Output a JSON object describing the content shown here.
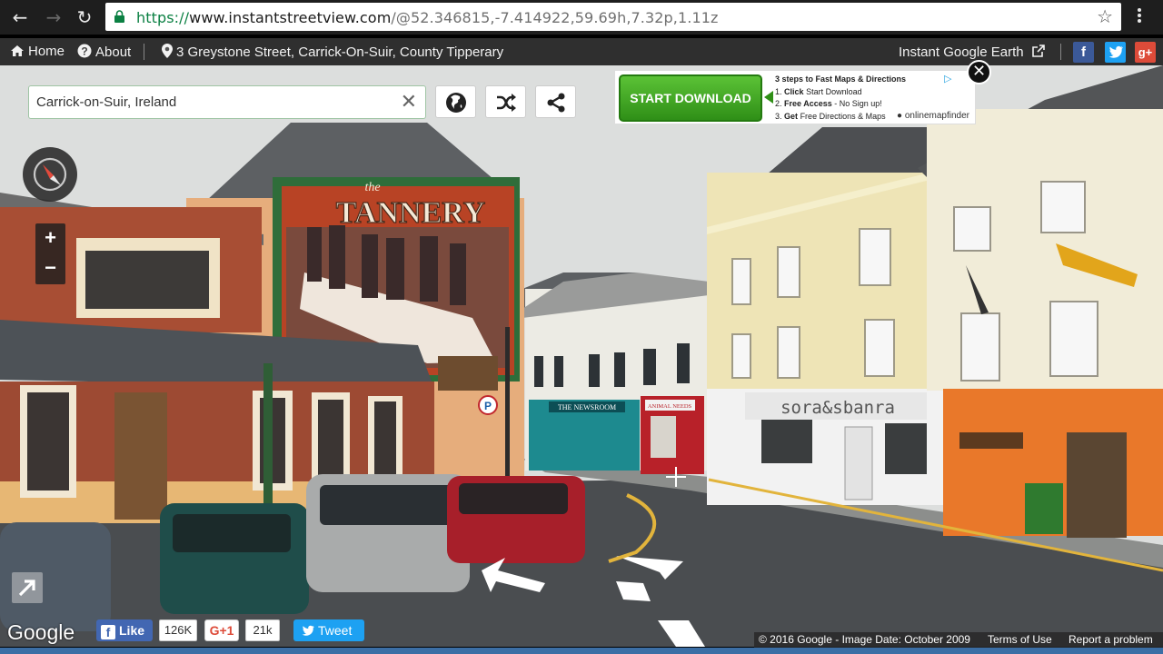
{
  "browser": {
    "url_proto": "https://",
    "url_domain": "www.instantstreetview.com",
    "url_path": "/@52.346815,-7.414922,59.69h,7.32p,1.11z"
  },
  "topbar": {
    "home": "Home",
    "about": "About",
    "location": "3 Greystone Street, Carrick-On-Suir, County Tipperary",
    "earth": "Instant Google Earth",
    "colors": {
      "facebook": "#3b5998",
      "twitter": "#1da1f2",
      "gplus": "#dd4b39"
    }
  },
  "search": {
    "value": "Carrick-on-Suir, Ireland"
  },
  "tools": [
    "globe-icon",
    "shuffle-icon",
    "share-icon"
  ],
  "zoom": {
    "plus": "+",
    "minus": "−"
  },
  "ad": {
    "button": "START DOWNLOAD",
    "heading": "3 steps to Fast Maps & Directions",
    "step1_num": "1.",
    "step1_bold": "Click",
    "step1_rest": "Start Download",
    "step2_num": "2.",
    "step2_bold": "Free Access",
    "step2_rest": "- No Sign up!",
    "step3_num": "3.",
    "step3_bold": "Get",
    "step3_rest": "Free Directions & Maps",
    "brand": "onlinemapfinder"
  },
  "scene": {
    "mural_title": "TANNERY",
    "mural_sub": "the",
    "shop1": "THE NEWSROOM",
    "shop2": "ANIMAL NEEDS",
    "shop3": "sora&sbanra"
  },
  "social": {
    "logo": "Google",
    "like": "Like",
    "like_count": "126K",
    "gplus": "G+1",
    "gplus_count": "21k",
    "tweet": "Tweet"
  },
  "footer": {
    "copyright": "© 2016 Google - Image Date: October 2009",
    "terms": "Terms of Use",
    "report": "Report a problem"
  }
}
